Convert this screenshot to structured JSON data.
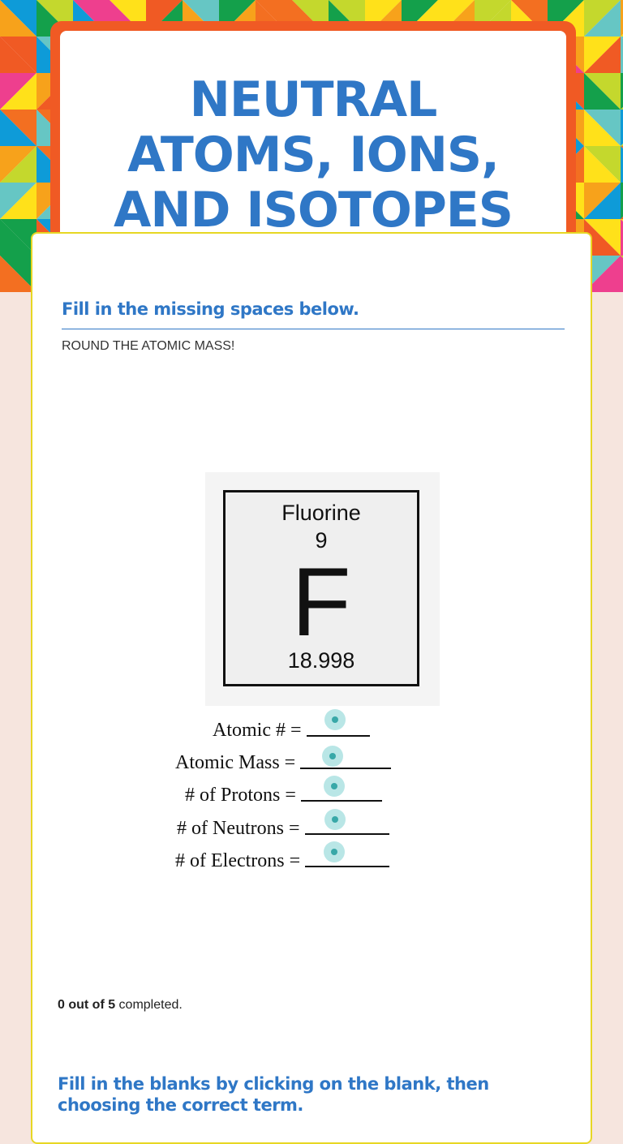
{
  "title": "NEUTRAL ATOMS, IONS, AND ISOTOPES",
  "section1": {
    "heading": "Fill in the missing spaces below.",
    "instruction": "ROUND THE ATOMIC MASS!"
  },
  "element": {
    "name": "Fluorine",
    "number": "9",
    "symbol": "F",
    "mass": "18.998"
  },
  "questions": [
    {
      "label": "Atomic # ="
    },
    {
      "label": "Atomic Mass ="
    },
    {
      "label": "# of Protons ="
    },
    {
      "label": "# of Neutrons ="
    },
    {
      "label": "# of Electrons ="
    }
  ],
  "progress": {
    "count": "0 out of 5",
    "suffix": " completed."
  },
  "section2": {
    "heading": "Fill in the blanks by clicking on the blank, then choosing the correct term."
  },
  "colors": {
    "accent_blue": "#2f77c6",
    "banner_orange": "#f05a24",
    "card_border": "#e7d723",
    "hotspot": "#38a8a8",
    "page_bg": "#f6e5de"
  }
}
